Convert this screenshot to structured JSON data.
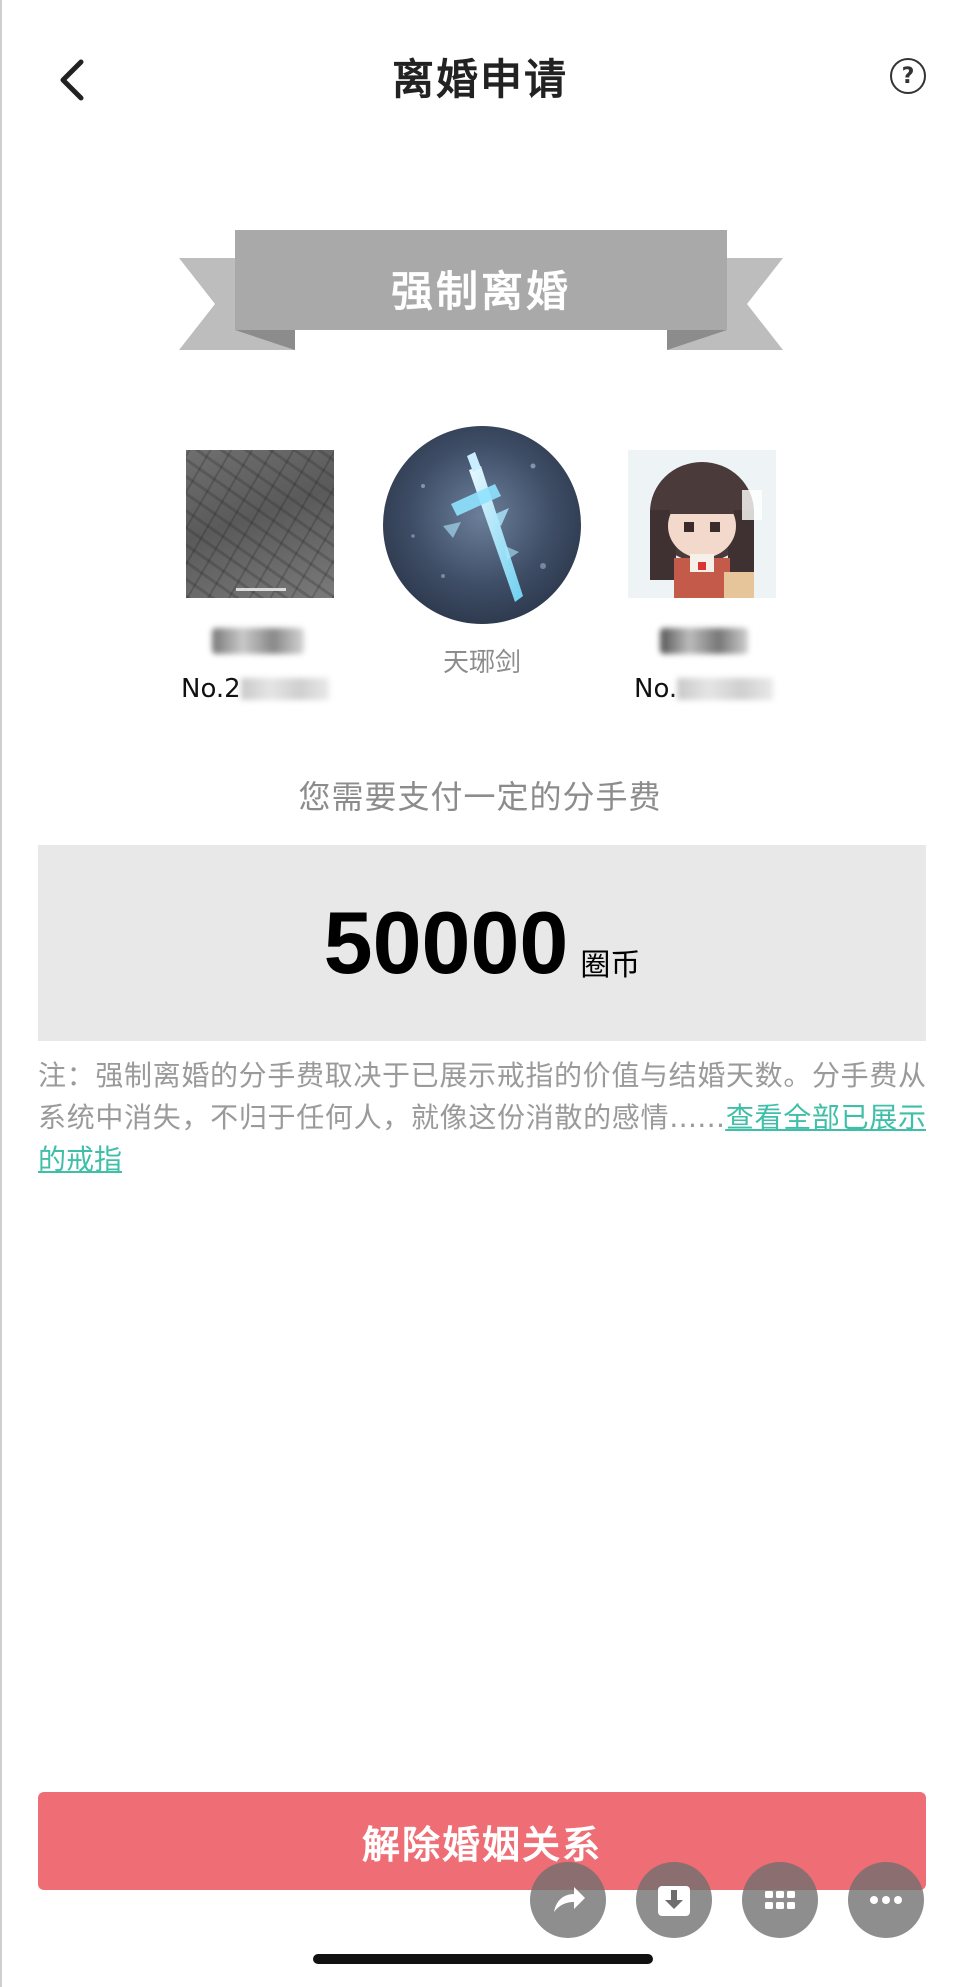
{
  "header": {
    "title": "离婚申请",
    "help_label": "?"
  },
  "banner": {
    "text": "强制离婚"
  },
  "participants": {
    "left": {
      "id_prefix": "No.2"
    },
    "ring": {
      "name": "天琊剑"
    },
    "right": {
      "id_prefix": "No."
    }
  },
  "fee": {
    "label": "您需要支付一定的分手费",
    "amount": "50000",
    "unit": "圈币"
  },
  "note": {
    "text": "注：强制离婚的分手费取决于已展示戒指的价值与结婚天数。分手费从系统中消失，不归于任何人，就像这份消散的感情……",
    "link": "查看全部已展示的戒指"
  },
  "action": {
    "label": "解除婚姻关系"
  },
  "floating_buttons": [
    "share-icon",
    "download-icon",
    "grid-icon",
    "more-icon"
  ],
  "colors": {
    "accent_red": "#ef6d74",
    "link_teal": "#3fbfa8",
    "banner_gray": "#a9a9a9"
  }
}
